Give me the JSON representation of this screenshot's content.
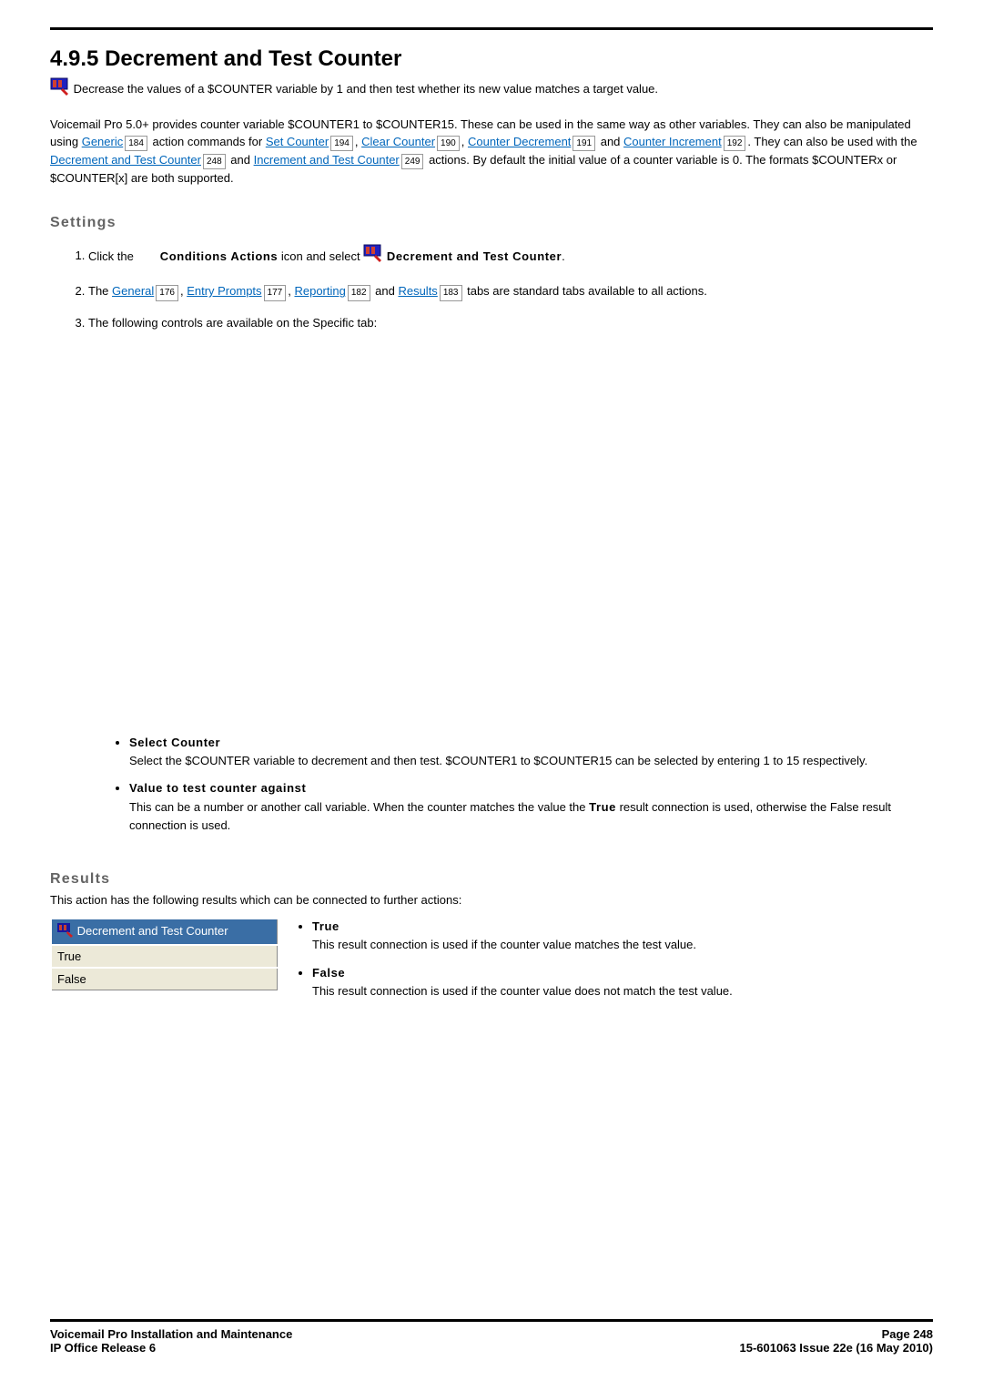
{
  "heading": {
    "number": "4.9.5",
    "title": "Decrement and Test Counter"
  },
  "intro": "Decrease the values of a $COUNTER variable by 1 and then test whether its new value matches a target value.",
  "para2_pre": "Voicemail Pro 5.0+ provides counter variable $COUNTER1 to $COUNTER15. These can be used in the same way as other variables. They can also be manipulated using  ",
  "links": {
    "generic": "Generic",
    "generic_pg": "184",
    "set_counter": "Set Counter",
    "set_counter_pg": "194",
    "clear_counter": "Clear Counter",
    "clear_counter_pg": "190",
    "counter_dec": "Counter Decrement",
    "counter_dec_pg": "191",
    "counter_inc": "Counter Increment",
    "counter_inc_pg": "192",
    "dec_test": "Decrement and Test Counter",
    "dec_test_pg": "248",
    "inc_test": "Increment and Test Counter",
    "inc_test_pg": "249",
    "tab_general": "General",
    "tab_general_pg": "176",
    "tab_entry": "Entry Prompts",
    "tab_entry_pg": "177",
    "tab_reporting": "Reporting",
    "tab_reporting_pg": "182",
    "tab_results": "Results",
    "tab_results_pg": "183"
  },
  "para2_mid1": " action commands for ",
  "para2_mid2": ", ",
  "para2_mid3": ", ",
  "para2_mid4": " and ",
  "para2_mid5": ". They can also be used with the ",
  "para2_mid6": " and ",
  "para2_mid7": " actions. By default the initial value of a counter variable is 0.  The formats $COUNTERx or $COUNTER[x] are both supported.",
  "settings_heading": "Settings",
  "step1_a": "Click the ",
  "step1_b": "Conditions Actions",
  "step1_c": " icon and select ",
  "step1_d": " Decrement and Test Counter",
  "step1_e": ".",
  "step2_a": "The ",
  "step2_b": " tabs are standard tabs available to all actions.",
  "step3": "The following controls are available on the Specific tab:",
  "bullet_selectcounter_h": "Select Counter",
  "bullet_selectcounter_t": "Select the $COUNTER variable to decrement and then test. $COUNTER1 to $COUNTER15 can be selected by entering 1 to 15 respectively.",
  "bullet_valuetest_h": "Value to test counter against",
  "bullet_valuetest_t_a": "This can be a number or another call variable. When the counter matches the value the ",
  "bullet_valuetest_t_true": "True",
  "bullet_valuetest_t_b": " result connection is used, otherwise the False result connection is used.",
  "results_heading": "Results",
  "results_intro": "This action has the following results which can be connected to further actions:",
  "table": {
    "hdr": "Decrement and Test Counter",
    "r1": "True",
    "r2": "False"
  },
  "res_true_h": "True",
  "res_true_t": "This result connection is used if the counter value matches the test value.",
  "res_false_h": "False",
  "res_false_t": "This result connection is used if the counter value does not match the test value.",
  "footer": {
    "left1": "Voicemail Pro Installation and Maintenance",
    "left2": "IP Office Release 6",
    "right1": "Page 248",
    "right2": "15-601063 Issue 22e (16 May 2010)"
  }
}
